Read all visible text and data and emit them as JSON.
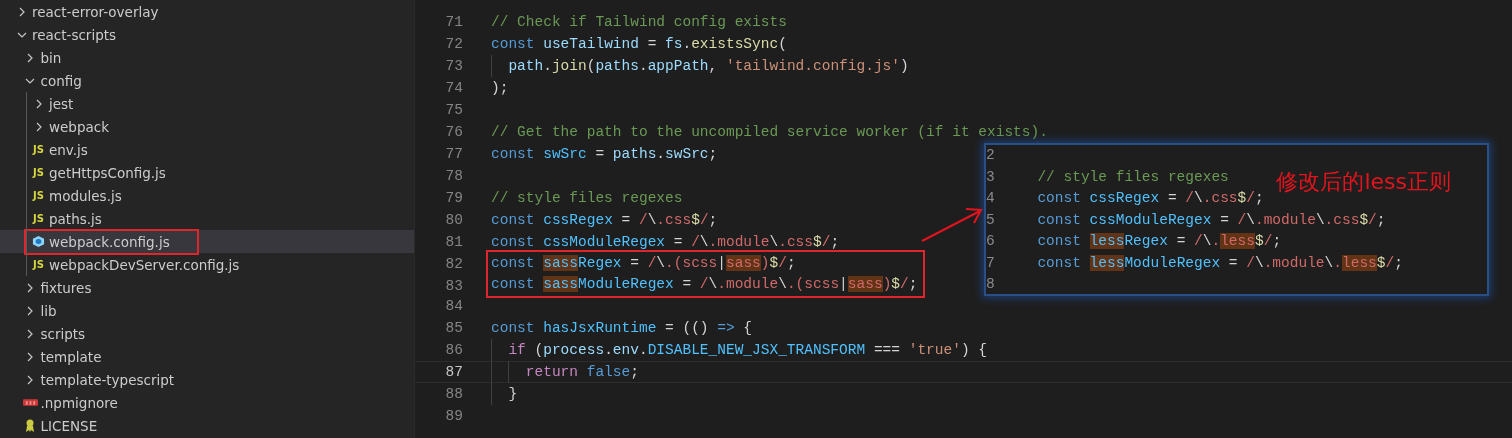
{
  "explorer": {
    "items": [
      {
        "label": "react-error-overlay",
        "kind": "folder",
        "expanded": false,
        "selected": false
      },
      {
        "label": "react-scripts",
        "kind": "folder",
        "expanded": true,
        "selected": false,
        "children": [
          {
            "label": "bin",
            "kind": "folder",
            "expanded": false,
            "selected": false
          },
          {
            "label": "config",
            "kind": "folder",
            "expanded": true,
            "selected": false,
            "children": [
              {
                "label": "jest",
                "kind": "folder",
                "expanded": false,
                "selected": false
              },
              {
                "label": "webpack",
                "kind": "folder",
                "expanded": false,
                "selected": false
              },
              {
                "label": "env.js",
                "kind": "js-file",
                "badge": "JS",
                "selected": false
              },
              {
                "label": "getHttpsConfig.js",
                "kind": "js-file",
                "badge": "JS",
                "selected": false
              },
              {
                "label": "modules.js",
                "kind": "js-file",
                "badge": "JS",
                "selected": false
              },
              {
                "label": "paths.js",
                "kind": "js-file",
                "badge": "JS",
                "selected": false
              },
              {
                "label": "webpack.config.js",
                "kind": "webpack-file",
                "selected": true,
                "annotated": true
              },
              {
                "label": "webpackDevServer.config.js",
                "kind": "js-file",
                "badge": "JS",
                "selected": false
              }
            ]
          },
          {
            "label": "fixtures",
            "kind": "folder",
            "expanded": false,
            "selected": false
          },
          {
            "label": "lib",
            "kind": "folder",
            "expanded": false,
            "selected": false
          },
          {
            "label": "scripts",
            "kind": "folder",
            "expanded": false,
            "selected": false
          },
          {
            "label": "template",
            "kind": "folder",
            "expanded": false,
            "selected": false
          },
          {
            "label": "template-typescript",
            "kind": "folder",
            "expanded": false,
            "selected": false
          },
          {
            "label": ".npmignore",
            "kind": "npm-file",
            "selected": false
          },
          {
            "label": "LICENSE",
            "kind": "license-file",
            "selected": false
          }
        ]
      }
    ]
  },
  "editor": {
    "lines": [
      {
        "number": "71",
        "tokens": [
          {
            "text": "// Check if Tailwind config exists",
            "kind": "comment"
          }
        ]
      },
      {
        "number": "72",
        "tokens": [
          {
            "text": "const ",
            "kind": "keyword"
          },
          {
            "text": "useTailwind",
            "kind": "variable"
          },
          {
            "text": " = ",
            "kind": "punct"
          },
          {
            "text": "fs",
            "kind": "variable"
          },
          {
            "text": ".",
            "kind": "punct"
          },
          {
            "text": "existsSync",
            "kind": "function"
          },
          {
            "text": "(",
            "kind": "punct"
          }
        ],
        "children": [
          {
            "number": "73",
            "tokens": [
              {
                "text": "path",
                "kind": "variable"
              },
              {
                "text": ".",
                "kind": "punct"
              },
              {
                "text": "join",
                "kind": "function"
              },
              {
                "text": "(",
                "kind": "punct"
              },
              {
                "text": "paths",
                "kind": "variable"
              },
              {
                "text": ".",
                "kind": "punct"
              },
              {
                "text": "appPath",
                "kind": "variable"
              },
              {
                "text": ", ",
                "kind": "punct"
              },
              {
                "text": "'tailwind.config.js'",
                "kind": "string"
              },
              {
                "text": ")",
                "kind": "punct"
              }
            ]
          }
        ]
      },
      {
        "number": "74",
        "tokens": [
          {
            "text": ");",
            "kind": "punct"
          }
        ]
      },
      {
        "number": "75"
      },
      {
        "number": "76",
        "tokens": [
          {
            "text": "// Get the path to the uncompiled service worker (if it exists).",
            "kind": "comment"
          }
        ]
      },
      {
        "number": "77",
        "tokens": [
          {
            "text": "const ",
            "kind": "keyword"
          },
          {
            "text": "swSrc",
            "kind": "constant"
          },
          {
            "text": " = ",
            "kind": "punct"
          },
          {
            "text": "paths",
            "kind": "variable"
          },
          {
            "text": ".",
            "kind": "punct"
          },
          {
            "text": "swSrc",
            "kind": "variable"
          },
          {
            "text": ";",
            "kind": "punct"
          }
        ]
      },
      {
        "number": "78"
      },
      {
        "number": "79",
        "tokens": [
          {
            "text": "// style files regexes",
            "kind": "comment"
          }
        ]
      },
      {
        "number": "80",
        "tokens": [
          {
            "text": "const ",
            "kind": "keyword"
          },
          {
            "text": "cssRegex",
            "kind": "constant"
          },
          {
            "text": " = ",
            "kind": "punct"
          },
          {
            "text": "/",
            "kind": "regex"
          },
          {
            "text": "\\",
            "kind": "escape"
          },
          {
            "text": ".css",
            "kind": "regex"
          },
          {
            "text": "$",
            "kind": "anchor"
          },
          {
            "text": "/",
            "kind": "regex"
          },
          {
            "text": ";",
            "kind": "punct"
          }
        ]
      },
      {
        "number": "81",
        "tokens": [
          {
            "text": "const ",
            "kind": "keyword"
          },
          {
            "text": "cssModuleRegex",
            "kind": "constant"
          },
          {
            "text": " = ",
            "kind": "punct"
          },
          {
            "text": "/",
            "kind": "regex"
          },
          {
            "text": "\\",
            "kind": "escape"
          },
          {
            "text": ".module",
            "kind": "regex"
          },
          {
            "text": "\\",
            "kind": "escape"
          },
          {
            "text": ".css",
            "kind": "regex"
          },
          {
            "text": "$",
            "kind": "anchor"
          },
          {
            "text": "/",
            "kind": "regex"
          },
          {
            "text": ";",
            "kind": "punct"
          }
        ]
      },
      {
        "number": "82",
        "boxed": true,
        "tokens": [
          {
            "text": "const ",
            "kind": "keyword"
          },
          {
            "text": "sass",
            "kind": "constant",
            "highlighted": true
          },
          {
            "text": "Regex",
            "kind": "constant"
          },
          {
            "text": " = ",
            "kind": "punct"
          },
          {
            "text": "/",
            "kind": "regex"
          },
          {
            "text": "\\",
            "kind": "escape"
          },
          {
            "text": ".(scss",
            "kind": "regex"
          },
          {
            "text": "|",
            "kind": "punct"
          },
          {
            "text": "sass",
            "kind": "regex",
            "highlighted": true
          },
          {
            "text": ")",
            "kind": "regex"
          },
          {
            "text": "$",
            "kind": "anchor"
          },
          {
            "text": "/",
            "kind": "regex"
          },
          {
            "text": ";",
            "kind": "punct"
          }
        ]
      },
      {
        "number": "83",
        "boxed": true,
        "tokens": [
          {
            "text": "const ",
            "kind": "keyword"
          },
          {
            "text": "sass",
            "kind": "constant",
            "highlighted": true
          },
          {
            "text": "ModuleRegex",
            "kind": "constant"
          },
          {
            "text": " = ",
            "kind": "punct"
          },
          {
            "text": "/",
            "kind": "regex"
          },
          {
            "text": "\\",
            "kind": "escape"
          },
          {
            "text": ".module",
            "kind": "regex"
          },
          {
            "text": "\\",
            "kind": "escape"
          },
          {
            "text": ".(scss",
            "kind": "regex"
          },
          {
            "text": "|",
            "kind": "punct"
          },
          {
            "text": "sass",
            "kind": "regex",
            "highlighted": true
          },
          {
            "text": ")",
            "kind": "regex"
          },
          {
            "text": "$",
            "kind": "anchor"
          },
          {
            "text": "/",
            "kind": "regex"
          },
          {
            "text": ";",
            "kind": "punct"
          }
        ]
      },
      {
        "number": "84"
      },
      {
        "number": "85",
        "tokens": [
          {
            "text": "const ",
            "kind": "keyword"
          },
          {
            "text": "hasJsxRuntime",
            "kind": "constant"
          },
          {
            "text": " = (() ",
            "kind": "punct"
          },
          {
            "text": "=>",
            "kind": "keyword"
          },
          {
            "text": " {",
            "kind": "punct"
          }
        ],
        "children": [
          {
            "number": "86",
            "tokens": [
              {
                "text": "if",
                "kind": "control"
              },
              {
                "text": " (",
                "kind": "punct"
              },
              {
                "text": "process",
                "kind": "variable"
              },
              {
                "text": ".",
                "kind": "punct"
              },
              {
                "text": "env",
                "kind": "variable"
              },
              {
                "text": ".",
                "kind": "punct"
              },
              {
                "text": "DISABLE_NEW_JSX_TRANSFORM",
                "kind": "constant"
              },
              {
                "text": " === ",
                "kind": "punct"
              },
              {
                "text": "'true'",
                "kind": "string"
              },
              {
                "text": ") {",
                "kind": "punct"
              }
            ],
            "children": [
              {
                "number": "87",
                "current": true,
                "tokens": [
                  {
                    "text": "return ",
                    "kind": "control"
                  },
                  {
                    "text": "false",
                    "kind": "keyword"
                  },
                  {
                    "text": ";",
                    "kind": "punct"
                  }
                ]
              }
            ]
          },
          {
            "number": "88",
            "tokens": [
              {
                "text": "}",
                "kind": "punct"
              }
            ]
          }
        ]
      },
      {
        "number": "89"
      }
    ]
  },
  "inset": {
    "note": "修改后的less正则",
    "lines": [
      {
        "number": "2"
      },
      {
        "number": "3",
        "indented": true,
        "tokens": [
          {
            "text": "// style files regexes",
            "kind": "comment"
          }
        ]
      },
      {
        "number": "4",
        "indented": true,
        "tokens": [
          {
            "text": "const ",
            "kind": "keyword"
          },
          {
            "text": "cssRegex",
            "kind": "constant"
          },
          {
            "text": " = ",
            "kind": "punct"
          },
          {
            "text": "/",
            "kind": "regex"
          },
          {
            "text": "\\",
            "kind": "escape"
          },
          {
            "text": ".css",
            "kind": "regex"
          },
          {
            "text": "$",
            "kind": "anchor"
          },
          {
            "text": "/",
            "kind": "regex"
          },
          {
            "text": ";",
            "kind": "punct"
          }
        ]
      },
      {
        "number": "5",
        "indented": true,
        "tokens": [
          {
            "text": "const ",
            "kind": "keyword"
          },
          {
            "text": "cssModuleRegex",
            "kind": "constant"
          },
          {
            "text": " = ",
            "kind": "punct"
          },
          {
            "text": "/",
            "kind": "regex"
          },
          {
            "text": "\\",
            "kind": "escape"
          },
          {
            "text": ".module",
            "kind": "regex"
          },
          {
            "text": "\\",
            "kind": "escape"
          },
          {
            "text": ".css",
            "kind": "regex"
          },
          {
            "text": "$",
            "kind": "anchor"
          },
          {
            "text": "/",
            "kind": "regex"
          },
          {
            "text": ";",
            "kind": "punct"
          }
        ]
      },
      {
        "number": "6",
        "indented": true,
        "tokens": [
          {
            "text": "const ",
            "kind": "keyword"
          },
          {
            "text": "less",
            "kind": "constant",
            "highlighted": true
          },
          {
            "text": "Regex",
            "kind": "constant"
          },
          {
            "text": " = ",
            "kind": "punct"
          },
          {
            "text": "/",
            "kind": "regex"
          },
          {
            "text": "\\",
            "kind": "escape"
          },
          {
            "text": ".",
            "kind": "regex"
          },
          {
            "text": "less",
            "kind": "regex",
            "highlighted": true
          },
          {
            "text": "$",
            "kind": "anchor"
          },
          {
            "text": "/",
            "kind": "regex"
          },
          {
            "text": ";",
            "kind": "punct"
          }
        ]
      },
      {
        "number": "7",
        "indented": true,
        "tokens": [
          {
            "text": "const ",
            "kind": "keyword"
          },
          {
            "text": "less",
            "kind": "constant",
            "highlighted": true
          },
          {
            "text": "ModuleRegex",
            "kind": "constant"
          },
          {
            "text": " = ",
            "kind": "punct"
          },
          {
            "text": "/",
            "kind": "regex"
          },
          {
            "text": "\\",
            "kind": "escape"
          },
          {
            "text": ".module",
            "kind": "regex"
          },
          {
            "text": "\\",
            "kind": "escape"
          },
          {
            "text": ".",
            "kind": "regex"
          },
          {
            "text": "less",
            "kind": "regex",
            "highlighted": true
          },
          {
            "text": "$",
            "kind": "anchor"
          },
          {
            "text": "/",
            "kind": "regex"
          },
          {
            "text": ";",
            "kind": "punct"
          }
        ]
      },
      {
        "number": "8"
      }
    ]
  }
}
